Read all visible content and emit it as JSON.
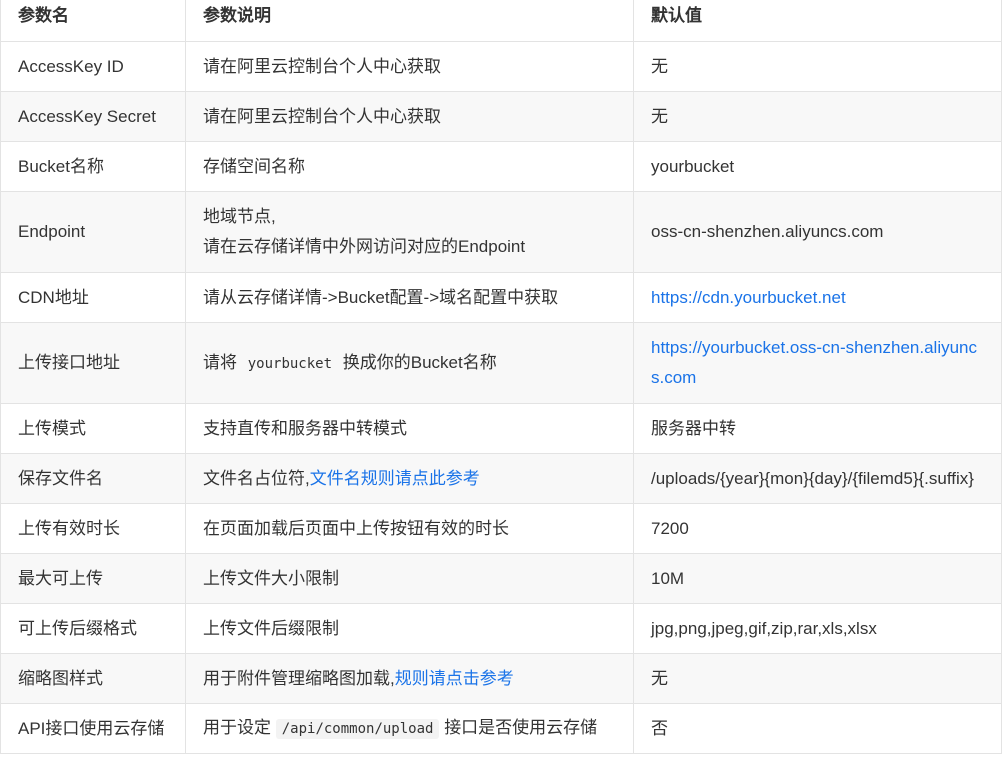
{
  "table": {
    "headers": {
      "name": "参数名",
      "desc": "参数说明",
      "default": "默认值"
    },
    "rows": [
      {
        "name": "AccessKey ID",
        "desc": "请在阿里云控制台个人中心获取",
        "default": "无"
      },
      {
        "name": "AccessKey Secret",
        "desc": "请在阿里云控制台个人中心获取",
        "default": "无"
      },
      {
        "name": "Bucket名称",
        "desc": "存储空间名称",
        "default": "yourbucket"
      },
      {
        "name": "Endpoint",
        "desc_line1": "地域节点,",
        "desc_line2": "请在云存储详情中外网访问对应的Endpoint",
        "default": "oss-cn-shenzhen.aliyuncs.com"
      },
      {
        "name": "CDN地址",
        "desc": "请从云存储详情->Bucket配置->域名配置中获取",
        "default_link": "https://cdn.yourbucket.net"
      },
      {
        "name": "上传接口地址",
        "desc_before": "请将",
        "desc_code": "yourbucket",
        "desc_after": "换成你的Bucket名称",
        "default_link": "https://yourbucket.oss-cn-shenzhen.aliyuncs.com"
      },
      {
        "name": "上传模式",
        "desc": "支持直传和服务器中转模式",
        "default": "服务器中转"
      },
      {
        "name": "保存文件名",
        "desc_before": "文件名占位符,",
        "desc_link": "文件名规则请点此参考",
        "default": "/uploads/{year}{mon}{day}/{filemd5}{.suffix}"
      },
      {
        "name": "上传有效时长",
        "desc": "在页面加载后页面中上传按钮有效的时长",
        "default": "7200"
      },
      {
        "name": "最大可上传",
        "desc": "上传文件大小限制",
        "default": "10M"
      },
      {
        "name": "可上传后缀格式",
        "desc": "上传文件后缀限制",
        "default": "jpg,png,jpeg,gif,zip,rar,xls,xlsx"
      },
      {
        "name": "缩略图样式",
        "desc_before": "用于附件管理缩略图加载,",
        "desc_link": "规则请点击参考",
        "default": "无"
      },
      {
        "name": "API接口使用云存储",
        "desc_before": "用于设定",
        "desc_code": "/api/common/upload",
        "desc_after": "接口是否使用云存储",
        "default": "否"
      }
    ]
  },
  "colors": {
    "link": "#1a73e8",
    "border": "#e3e3e3",
    "stripe": "#f8f8f8",
    "text": "#333333"
  }
}
